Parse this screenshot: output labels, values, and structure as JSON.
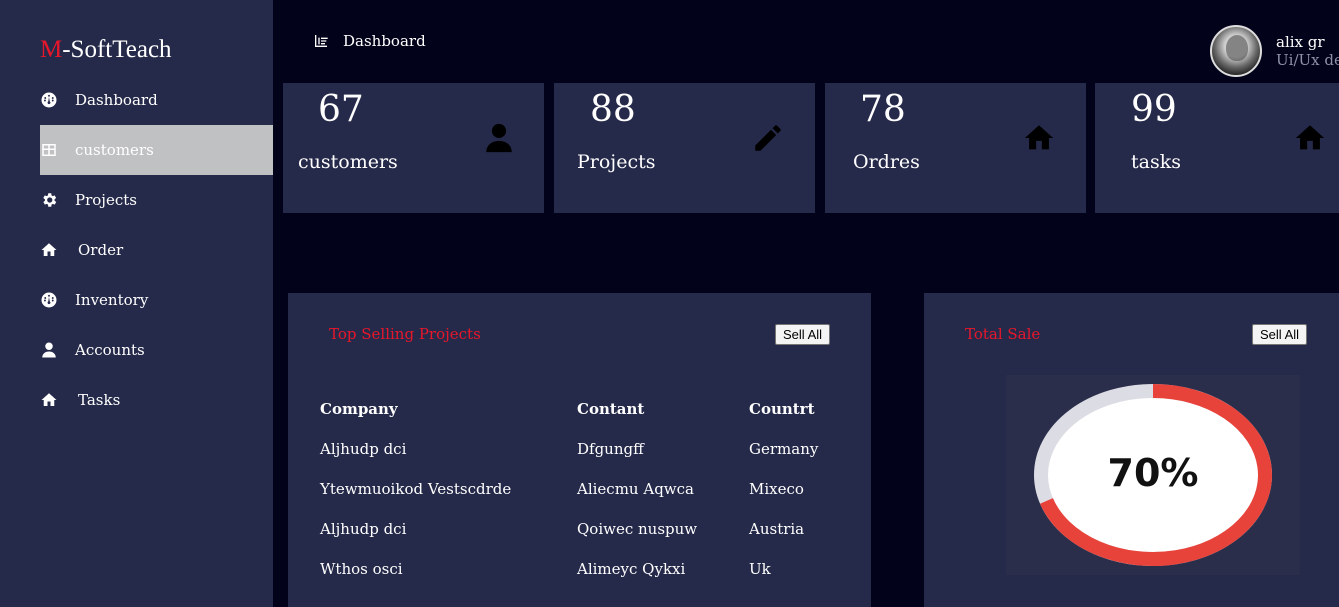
{
  "brand": {
    "first": "M",
    "rest": "-SoftTeach"
  },
  "sidebar": {
    "items": [
      {
        "label": "Dashboard",
        "icon": "dashboard-icon"
      },
      {
        "label": "customers",
        "icon": "table-icon"
      },
      {
        "label": "Projects",
        "icon": "gear-icon"
      },
      {
        "label": "Order",
        "icon": "home-icon"
      },
      {
        "label": "Inventory",
        "icon": "dashboard-icon"
      },
      {
        "label": "Accounts",
        "icon": "user-icon"
      },
      {
        "label": "Tasks",
        "icon": "home-icon"
      }
    ]
  },
  "header": {
    "title": "Dashboard",
    "icon": "chart-bar-icon"
  },
  "user": {
    "name": "alix gr",
    "role": "Ui/Ux designer"
  },
  "stats": [
    {
      "value": "67",
      "label": "customers",
      "icon": "user-icon"
    },
    {
      "value": "88",
      "label": "Projects",
      "icon": "pen-icon"
    },
    {
      "value": "78",
      "label": "Ordres",
      "icon": "home-icon"
    },
    {
      "value": "99",
      "label": "tasks",
      "icon": "home-icon"
    }
  ],
  "top_projects": {
    "title": "Top Selling Projects",
    "button": "Sell All",
    "columns": [
      "Company",
      "Contant",
      "Countrt"
    ],
    "rows": [
      [
        "Aljhudp dci",
        "Dfgungff",
        "Germany"
      ],
      [
        "Ytewmuoikod Vestscdrde",
        "Aliecmu Aqwca",
        "Mixeco"
      ],
      [
        "Aljhudp dci",
        "Qoiwec nuspuw",
        "Austria"
      ],
      [
        "Wthos osci",
        "Alimeyc Qykxi",
        "Uk"
      ]
    ]
  },
  "total_sale": {
    "title": "Total Sale",
    "button": "Sell All",
    "percent_label": "70%",
    "percent": 70,
    "colors": {
      "filled": "#e8433a",
      "empty": "#dcdce4"
    }
  },
  "colors": {
    "accent": "#e8162b",
    "sidebar": "#262a4a",
    "background": "#02021a"
  }
}
